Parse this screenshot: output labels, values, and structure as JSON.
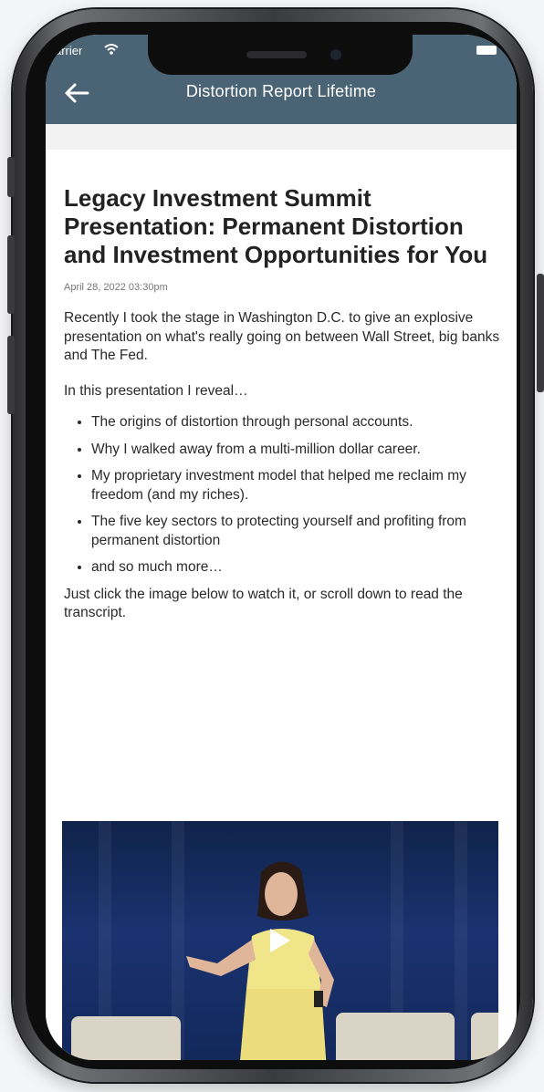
{
  "status_bar": {
    "carrier": "arrier"
  },
  "header": {
    "title": "Distortion Report Lifetime",
    "back_icon": "arrow-left-icon"
  },
  "article": {
    "headline": "Legacy Investment Summit Presentation: Permanent Distortion and Investment Opportunities for You",
    "date": "April 28, 2022 03:30pm",
    "intro": "Recently I took the stage in Washington D.C. to give an explosive presentation on what's really going on between Wall Street, big banks and The Fed.",
    "lead": "In this presentation I reveal…",
    "bullets": [
      "The origins of distortion through personal accounts.",
      "Why I walked away from a multi-million dollar career.",
      "My proprietary investment model that helped me reclaim my freedom (and my riches).",
      "The five key sectors to protecting yourself and profiting from permanent distortion",
      "and so much more…"
    ],
    "cta": "Just click the image below to watch it, or scroll down to read the transcript."
  },
  "colors": {
    "header_bg": "#4a6375",
    "video_bg": "#1a3270"
  }
}
